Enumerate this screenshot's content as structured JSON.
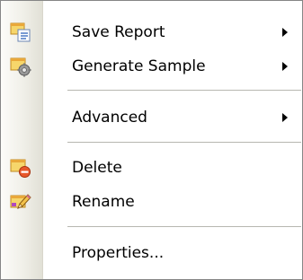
{
  "menu": {
    "items": [
      {
        "label": "Save Report",
        "icon": "save-report-icon",
        "submenu": true
      },
      {
        "label": "Generate Sample",
        "icon": "generate-sample-icon",
        "submenu": true
      },
      {
        "label": "Advanced",
        "submenu": true
      },
      {
        "label": "Delete",
        "icon": "delete-icon",
        "submenu": false
      },
      {
        "label": "Rename",
        "icon": "rename-icon",
        "submenu": false
      },
      {
        "label": "Properties...",
        "submenu": false
      }
    ]
  }
}
